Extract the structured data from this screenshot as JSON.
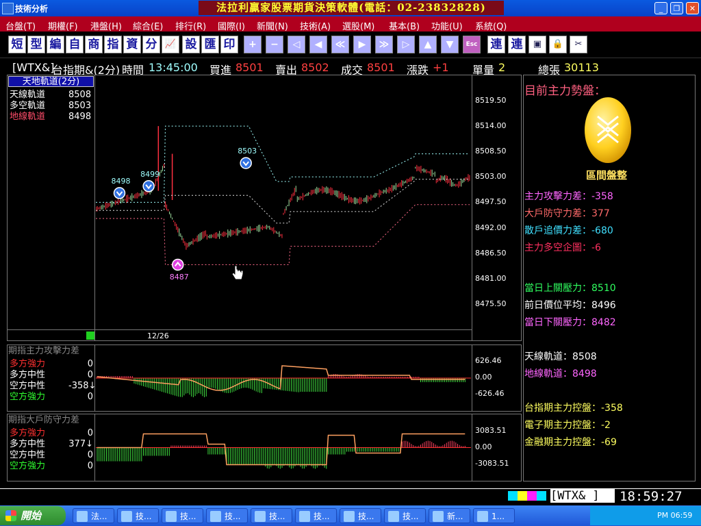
{
  "window": {
    "title": "技術分析",
    "banner": "法拉利贏家股票期貨決策軟體(電話：02-23832828)",
    "buttons": {
      "minimize": "_",
      "restore": "❐",
      "close": "✕"
    }
  },
  "menu": [
    "台盤(T)",
    "期權(F)",
    "港盤(H)",
    "綜合(E)",
    "排行(R)",
    "國際(I)",
    "新聞(N)",
    "技術(A)",
    "選股(M)",
    "基本(B)",
    "功能(U)",
    "系統(Q)"
  ],
  "toolbar": {
    "text_buttons": [
      "短",
      "型",
      "編",
      "自",
      "商",
      "指",
      "資",
      "分"
    ],
    "text_buttons2": [
      "設",
      "匯",
      "印"
    ],
    "nav_buttons": [
      "+",
      "−",
      "◁",
      "◀",
      "≪",
      "▶",
      "≫",
      "▷",
      "▲",
      "▼"
    ],
    "esc": "Esc",
    "link_buttons": [
      "連",
      "連"
    ]
  },
  "info_bar": {
    "symbol": "[WTX&]",
    "name": "台指期&(2分)",
    "time_label": "時間",
    "time": "13:45:00",
    "bid_label": "買進",
    "bid": "8501",
    "ask_label": "賣出",
    "ask": "8502",
    "last_label": "成交",
    "last": "8501",
    "change_label": "漲跌",
    "change": "+1",
    "volume_label": "單量",
    "volume": "2",
    "total_label": "總張",
    "total": "30113"
  },
  "main_chart": {
    "legend_title": "天地軌道(2分)",
    "legend": [
      {
        "name": "天線軌道",
        "value": "8508",
        "color": "#ffffff"
      },
      {
        "name": "多空軌道",
        "value": "8503",
        "color": "#ffffff"
      },
      {
        "name": "地線軌道",
        "value": "8498",
        "color": "#ff4d6a"
      }
    ],
    "y_ticks": [
      "8519.50",
      "8514.00",
      "8508.50",
      "8503.00",
      "8497.50",
      "8492.00",
      "8486.50",
      "8481.00",
      "8475.50"
    ],
    "date_label": "12/26",
    "markers": [
      {
        "label": "8498",
        "type": "down"
      },
      {
        "label": "8499",
        "type": "down"
      },
      {
        "label": "8503",
        "type": "down"
      },
      {
        "label": "8487",
        "type": "up"
      }
    ]
  },
  "attack_panel": {
    "title": "期指主力攻擊力差",
    "rows": [
      {
        "name": "多方強力",
        "value": "0",
        "color": "#ff3030"
      },
      {
        "name": "多方中性",
        "value": "0",
        "color": "#ffffff"
      },
      {
        "name": "空方中性",
        "value": "-358↓",
        "color": "#ffffff"
      },
      {
        "name": "空方強力",
        "value": "0",
        "color": "#30ff30"
      }
    ],
    "y_ticks": [
      "626.46",
      "0.00",
      "-626.46"
    ]
  },
  "defense_panel": {
    "title": "期指大戶防守力差",
    "rows": [
      {
        "name": "多方強力",
        "value": "0",
        "color": "#ff3030"
      },
      {
        "name": "多方中性",
        "value": "377↓",
        "color": "#ffffff"
      },
      {
        "name": "空方中性",
        "value": "0",
        "color": "#ffffff"
      },
      {
        "name": "空方強力",
        "value": "0",
        "color": "#30ff30"
      }
    ],
    "y_ticks": [
      "3083.51",
      "0.00",
      "-3083.51"
    ]
  },
  "right_panel": {
    "heading": "目前主力勢盤：",
    "trend": "區間盤整",
    "stats": [
      {
        "label": "主力攻擊力差：",
        "value": "-358",
        "color": "#ff66ff"
      },
      {
        "label": "大戶防守力差：",
        "value": "377",
        "color": "#ff6a6a"
      },
      {
        "label": "散戶追價力差：",
        "value": "-680",
        "color": "#40e0ff"
      },
      {
        "label": "主力多空企圖：",
        "value": "-6",
        "color": "#ff3060"
      }
    ],
    "pressure": [
      {
        "label": "當日上關壓力：",
        "value": "8510",
        "color": "#30ff60"
      },
      {
        "label": "前日價位平均：",
        "value": "8496",
        "color": "#ffffff"
      },
      {
        "label": "當日下關壓力：",
        "value": "8482",
        "color": "#ff66ff"
      }
    ],
    "tracks": [
      {
        "label": "天線軌道：",
        "value": "8508",
        "color": "#ffffff"
      },
      {
        "label": "地線軌道：",
        "value": "8498",
        "color": "#ff66ff"
      }
    ],
    "control": [
      {
        "label": "台指期主力控盤：",
        "value": "-358",
        "color": "#ffff60"
      },
      {
        "label": "電子期主力控盤：",
        "value": "-2",
        "color": "#ffff60"
      },
      {
        "label": "金融期主力控盤：",
        "value": "-69",
        "color": "#ffff60"
      }
    ]
  },
  "status": {
    "symbol": "[WTX&    ]",
    "clock": "18:59:27"
  },
  "taskbar": {
    "start": "開始",
    "tasks": [
      "法...",
      "技...",
      "技...",
      "技...",
      "技...",
      "技...",
      "技...",
      "技...",
      "新...",
      "1..."
    ],
    "time": "PM 06:59"
  },
  "colors": {
    "menu_bg": "#b0001e",
    "up": "#ff3030",
    "down": "#30ff30",
    "track_cyan": "#a0ffff",
    "track_red": "#ff6a8a",
    "accent_yellow": "#ffd020"
  }
}
